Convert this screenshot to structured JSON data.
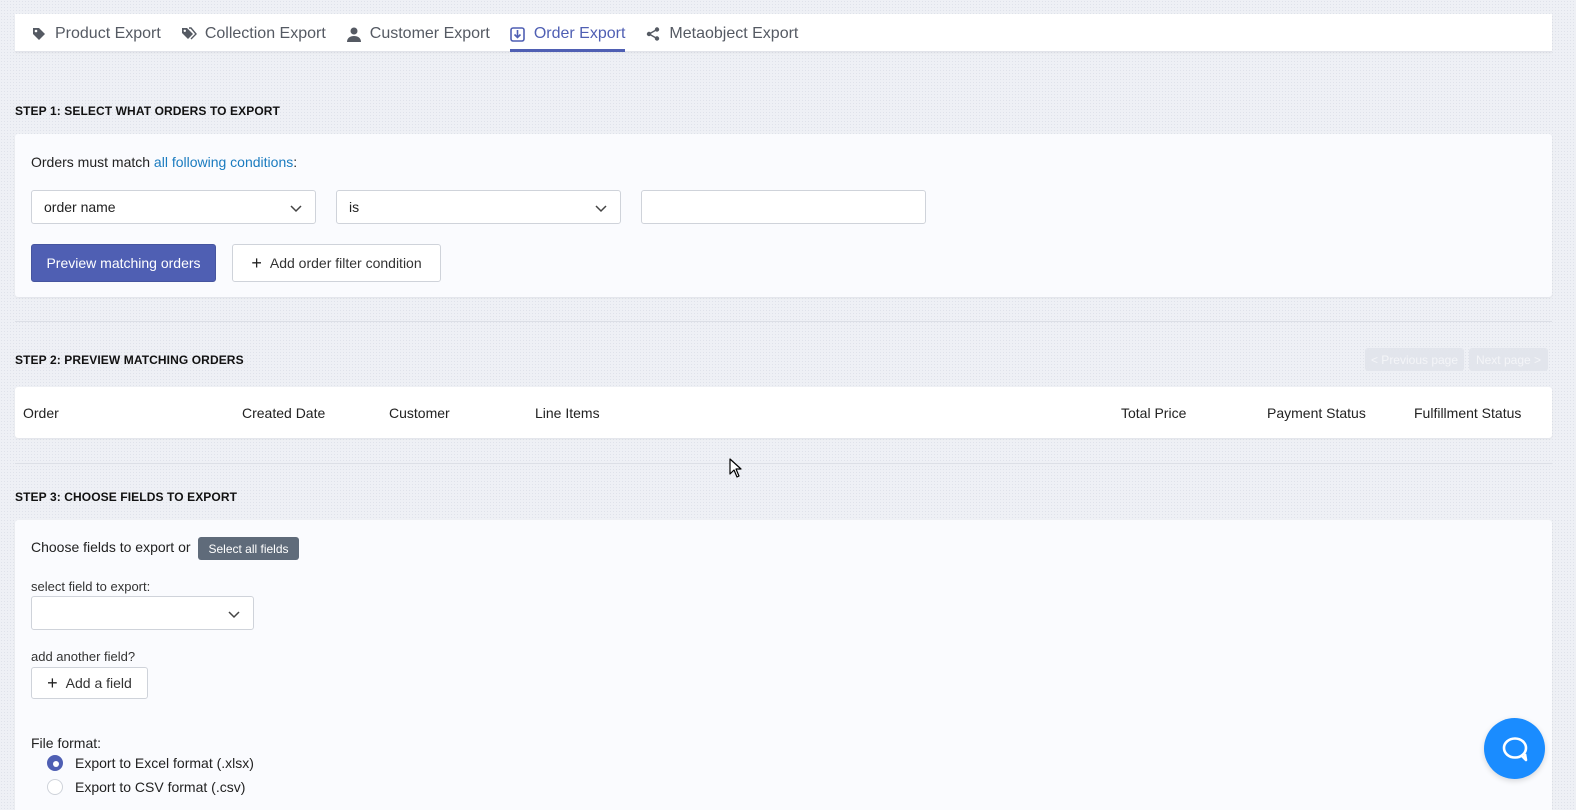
{
  "tabs": [
    {
      "label": "Product Export",
      "icon": "tag-icon",
      "active": false
    },
    {
      "label": "Collection Export",
      "icon": "tags-icon",
      "active": false
    },
    {
      "label": "Customer Export",
      "icon": "user-icon",
      "active": false
    },
    {
      "label": "Order Export",
      "icon": "download-box-icon",
      "active": true
    },
    {
      "label": "Metaobject Export",
      "icon": "share-icon",
      "active": false
    }
  ],
  "step1": {
    "title": "STEP 1: SELECT WHAT ORDERS TO EXPORT",
    "conditions_prefix": "Orders must match ",
    "conditions_link": "all following conditions",
    "conditions_suffix": ":",
    "field_select": "order name",
    "operator_select": "is",
    "value_input": "",
    "preview_button": "Preview matching orders",
    "add_condition_button": "Add order filter condition"
  },
  "step2": {
    "title": "STEP 2: PREVIEW MATCHING ORDERS",
    "prev_page": "< Previous page",
    "next_page": "Next page >",
    "columns": [
      "Order",
      "Created Date",
      "Customer",
      "Line Items",
      "Total Price",
      "Payment Status",
      "Fulfillment Status"
    ]
  },
  "step3": {
    "title": "STEP 3: CHOOSE FIELDS TO EXPORT",
    "choose_text": "Choose fields to export or",
    "select_all_button": "Select all fields",
    "select_field_label": "select field to export:",
    "select_field_value": "",
    "add_another_label": "add another field?",
    "add_field_button": "Add a field",
    "file_format_label": "File format:",
    "formats": [
      {
        "label": "Export to Excel format (.xlsx)",
        "checked": true
      },
      {
        "label": "Export to CSV format (.csv)",
        "checked": false
      }
    ]
  },
  "colors": {
    "accent": "#4f5fb3",
    "link": "#1a7bbf",
    "chat": "#1a8cff"
  },
  "chat_icon": "chat-bubble-icon"
}
